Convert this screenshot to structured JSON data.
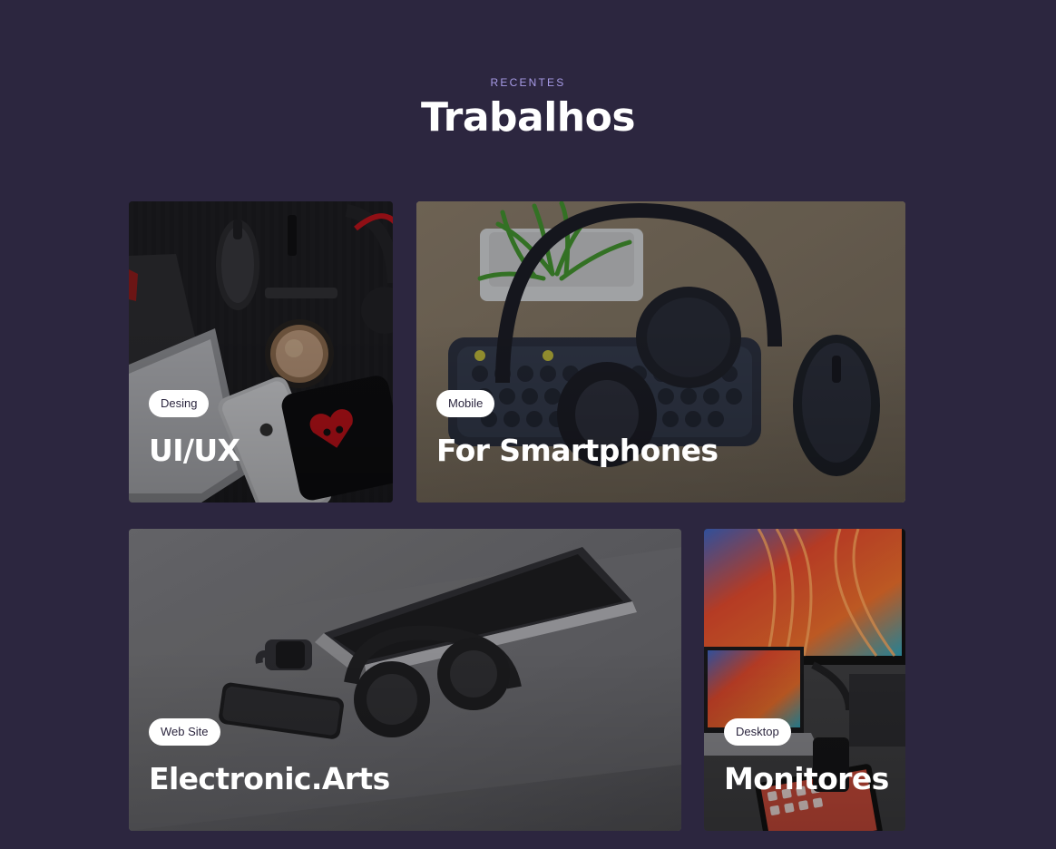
{
  "section": {
    "eyebrow": "RECENTES",
    "heading": "Trabalhos"
  },
  "cards": [
    {
      "tag": "Desing",
      "title": "UI/UX"
    },
    {
      "tag": "Mobile",
      "title": "For Smartphones"
    },
    {
      "tag": "Web Site",
      "title": "Electronic.Arts"
    },
    {
      "tag": "Desktop",
      "title": "Monitores"
    }
  ],
  "colors": {
    "background": "#2c263f",
    "eyebrow": "#a79be6",
    "tag_background": "#ffffff",
    "tag_text": "#2c263f"
  }
}
